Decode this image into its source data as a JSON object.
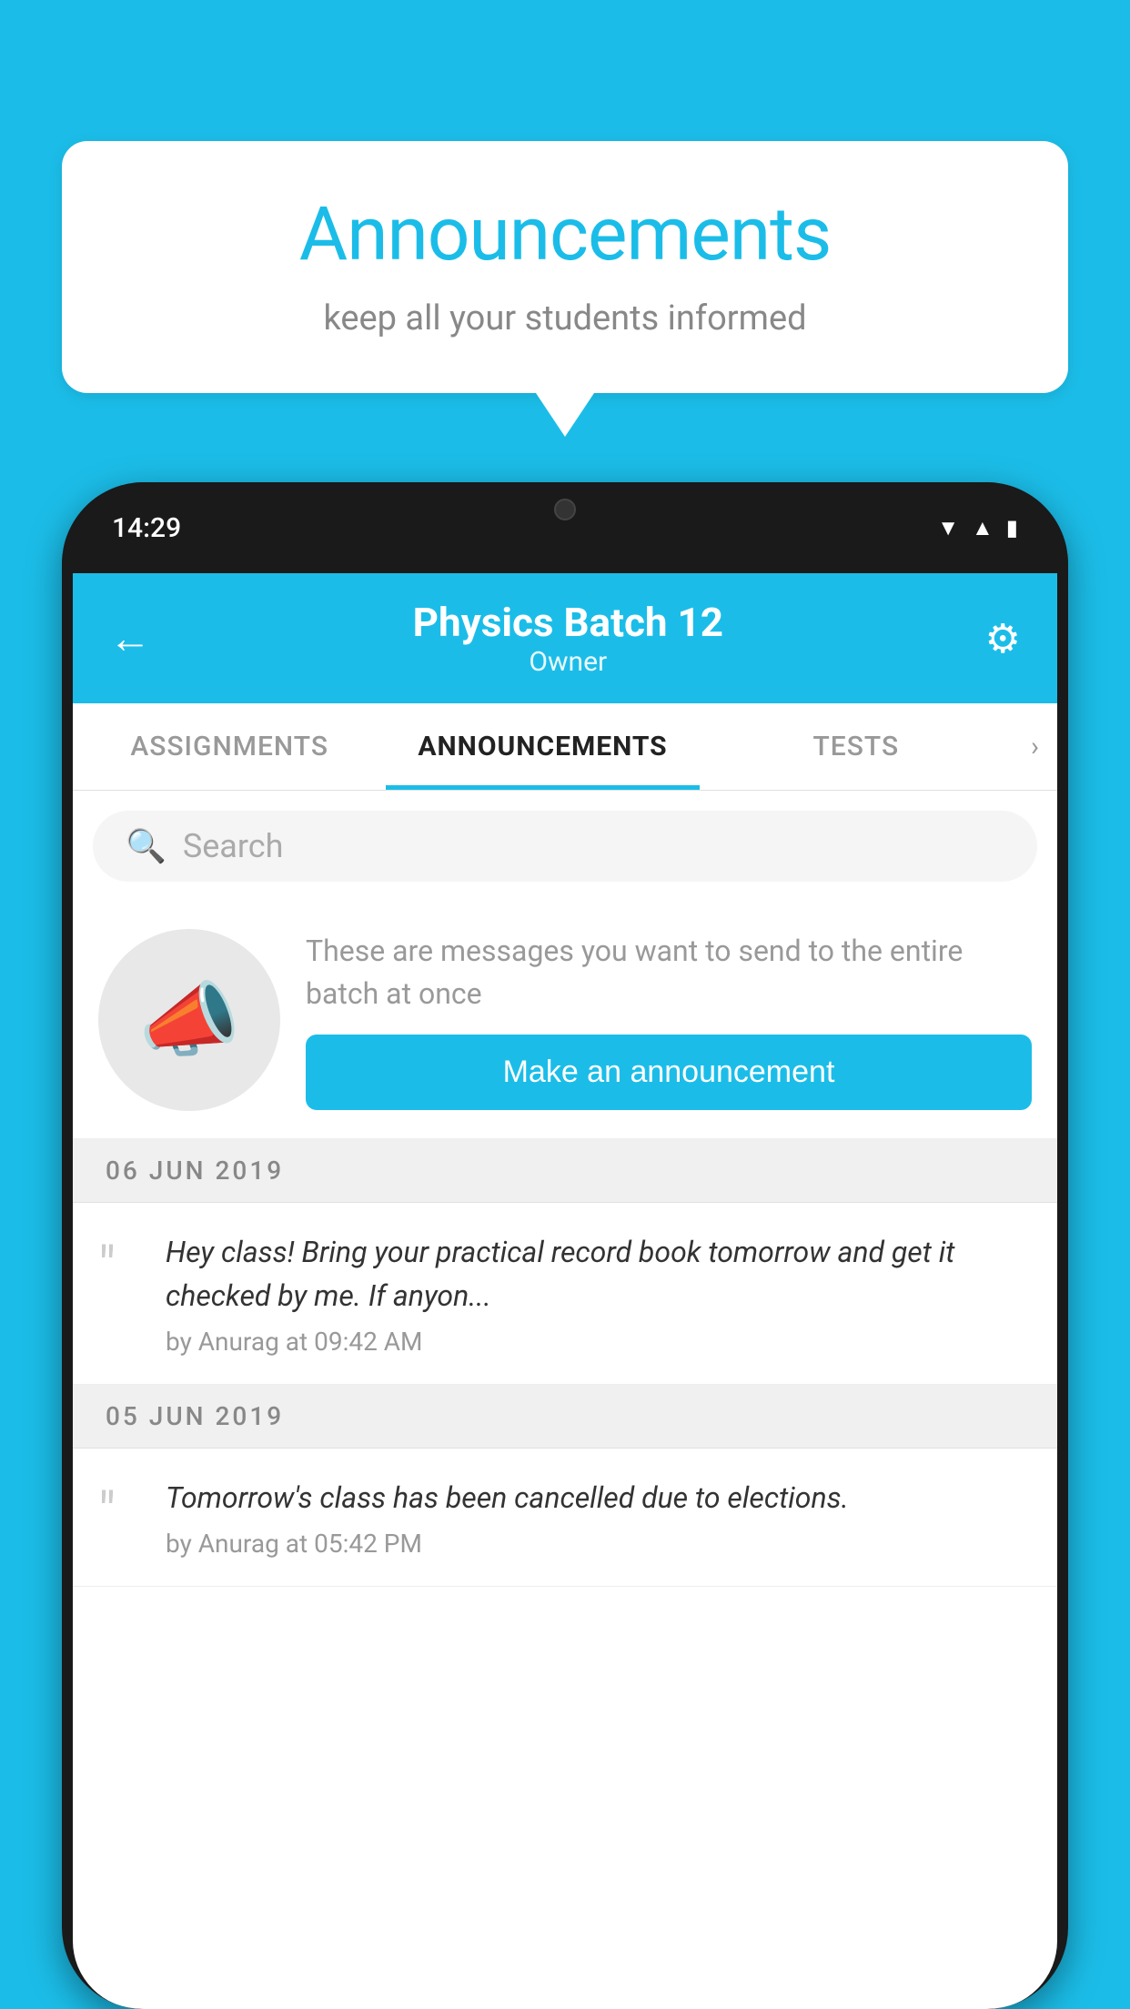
{
  "background_color": "#1bbde8",
  "speech_bubble": {
    "title": "Announcements",
    "subtitle": "keep all your students informed"
  },
  "phone": {
    "status_bar": {
      "time": "14:29",
      "icons": [
        "wifi",
        "signal",
        "battery"
      ]
    },
    "header": {
      "title": "Physics Batch 12",
      "subtitle": "Owner",
      "back_label": "←",
      "settings_label": "⚙"
    },
    "tabs": [
      {
        "label": "ASSIGNMENTS",
        "active": false
      },
      {
        "label": "ANNOUNCEMENTS",
        "active": true
      },
      {
        "label": "TESTS",
        "active": false
      }
    ],
    "search": {
      "placeholder": "Search"
    },
    "announcement_prompt": {
      "description": "These are messages you want to send to the entire batch at once",
      "button_label": "Make an announcement"
    },
    "announcements": [
      {
        "date": "06  JUN  2019",
        "text": "Hey class! Bring your practical record book tomorrow and get it checked by me. If anyon...",
        "meta": "by Anurag at 09:42 AM"
      },
      {
        "date": "05  JUN  2019",
        "text": "Tomorrow's class has been cancelled due to elections.",
        "meta": "by Anurag at 05:42 PM"
      }
    ]
  }
}
